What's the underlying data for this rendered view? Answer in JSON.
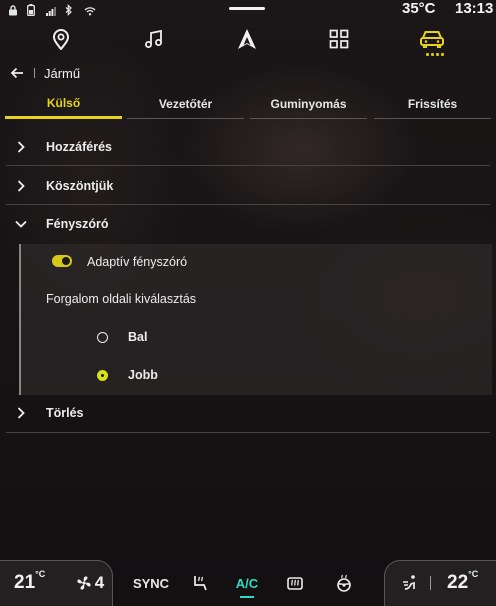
{
  "status_bar": {
    "temperature": "35°C",
    "time": "13:13",
    "icons": [
      "lock-icon",
      "battery-icon",
      "signal-icon",
      "bluetooth-icon",
      "wifi-icon"
    ]
  },
  "top_nav": {
    "items": [
      "location-pin-icon",
      "music-note-icon",
      "android-auto-icon",
      "apps-grid-icon",
      "vehicle-icon"
    ],
    "active_item": "vehicle-icon",
    "accent_color": "#e6d31a"
  },
  "breadcrumb": {
    "title": "Jármű"
  },
  "tabs": [
    {
      "label": "Külső",
      "active": true
    },
    {
      "label": "Vezetőtér",
      "active": false
    },
    {
      "label": "Guminyomás",
      "active": false
    },
    {
      "label": "Frissítés",
      "active": false
    }
  ],
  "settings": {
    "access": "Hozzáférés",
    "welcome": "Köszöntjük",
    "headlights": {
      "label": "Fényszóró",
      "adaptive_label": "Adaptív fényszóró",
      "adaptive_enabled": true,
      "traffic_side_label": "Forgalom oldali kiválasztás",
      "options": [
        {
          "label": "Bal",
          "selected": false
        },
        {
          "label": "Jobb",
          "selected": true
        }
      ]
    },
    "delete": "Törlés"
  },
  "climate": {
    "left_temp": "21",
    "right_temp": "22",
    "temp_unit": "°C",
    "fan_level": "4",
    "sync_label": "SYNC",
    "ac_label": "A/C",
    "ac_color": "#33d9c2"
  }
}
